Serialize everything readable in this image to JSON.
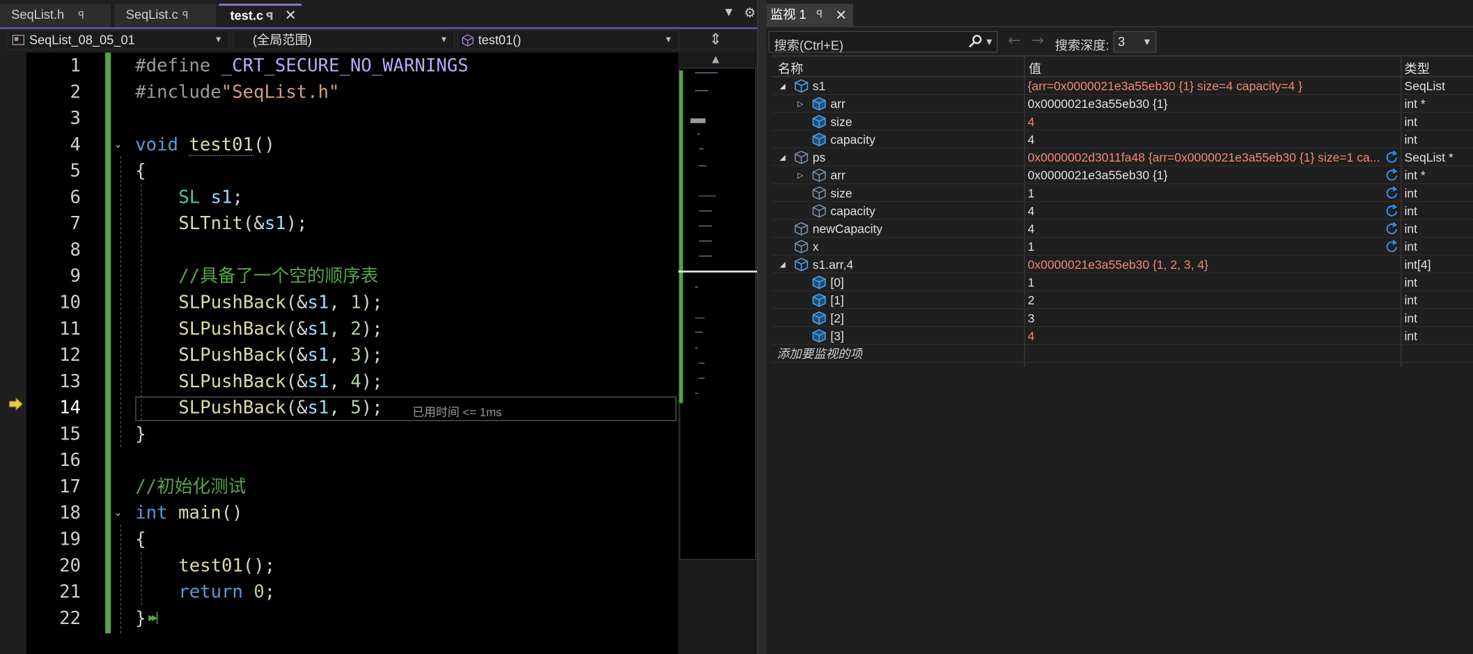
{
  "editor": {
    "tabs": [
      {
        "label": "SeqList.h"
      },
      {
        "label": "SeqList.c"
      },
      {
        "label": "test.c",
        "active": true
      }
    ],
    "nav": {
      "project": "SeqList_08_05_01",
      "scope": "(全局范围)",
      "member": "test01()"
    },
    "line_numbers": [
      "1",
      "2",
      "3",
      "4",
      "5",
      "6",
      "7",
      "8",
      "9",
      "10",
      "11",
      "12",
      "13",
      "14",
      "15",
      "16",
      "17",
      "18",
      "19",
      "20",
      "21",
      "22"
    ],
    "current_line": 14,
    "code": {
      "l1": {
        "a": "#define ",
        "b": "_CRT_SECURE_NO_WARNINGS"
      },
      "l2": {
        "a": "#include",
        "b": "\"SeqList.h\""
      },
      "l4": {
        "a": "void ",
        "b": "test01",
        "c": "()"
      },
      "l5": "{",
      "l6": {
        "a": "SL ",
        "b": "s1",
        "c": ";"
      },
      "l7": {
        "a": "SLTnit",
        "b": "(&",
        "c": "s1",
        "d": ");"
      },
      "l9": "//具备了一个空的顺序表",
      "l10": {
        "a": "SLPushBack",
        "b": "(&",
        "c": "s1",
        "d": ", ",
        "e": "1",
        "f": ");"
      },
      "l11": {
        "a": "SLPushBack",
        "b": "(&",
        "c": "s1",
        "d": ", ",
        "e": "2",
        "f": ");"
      },
      "l12": {
        "a": "SLPushBack",
        "b": "(&",
        "c": "s1",
        "d": ", ",
        "e": "3",
        "f": ");"
      },
      "l13": {
        "a": "SLPushBack",
        "b": "(&",
        "c": "s1",
        "d": ", ",
        "e": "4",
        "f": ");"
      },
      "l14": {
        "a": "SLPushBack",
        "b": "(&",
        "c": "s1",
        "d": ", ",
        "e": "5",
        "f": ");"
      },
      "l15": "}",
      "l17": "//初始化测试",
      "l18": {
        "a": "int ",
        "b": "main",
        "c": "()"
      },
      "l19": "{",
      "l20": {
        "a": "test01",
        "b": "();"
      },
      "l21": {
        "a": "return ",
        "b": "0",
        "c": ";"
      },
      "l22": "}"
    },
    "elapsed_hint": "已用时间 <= 1ms"
  },
  "watch": {
    "title": "监视 1",
    "search_placeholder": "搜索(Ctrl+E)",
    "depth_label": "搜索深度:",
    "depth_value": "3",
    "columns": {
      "name": "名称",
      "value": "值",
      "type": "类型"
    },
    "rows": [
      {
        "name": "s1",
        "value": "{arr=0x0000021e3a55eb30 {1} size=4 capacity=4 }",
        "type": "SeqList"
      },
      {
        "name": "arr",
        "value": "0x0000021e3a55eb30 {1}",
        "type": "int *"
      },
      {
        "name": "size",
        "value": "4",
        "type": "int"
      },
      {
        "name": "capacity",
        "value": "4",
        "type": "int"
      },
      {
        "name": "ps",
        "value": "0x0000002d3011fa48 {arr=0x0000021e3a55eb30 {1} size=1 ca...",
        "type": "SeqList *"
      },
      {
        "name": "arr",
        "value": "0x0000021e3a55eb30 {1}",
        "type": "int *"
      },
      {
        "name": "size",
        "value": "1",
        "type": "int"
      },
      {
        "name": "capacity",
        "value": "4",
        "type": "int"
      },
      {
        "name": "newCapacity",
        "value": "4",
        "type": "int"
      },
      {
        "name": "x",
        "value": "1",
        "type": "int"
      },
      {
        "name": "s1.arr,4",
        "value": "0x0000021e3a55eb30 {1, 2, 3, 4}",
        "type": "int[4]"
      },
      {
        "name": "[0]",
        "value": "1",
        "type": "int"
      },
      {
        "name": "[1]",
        "value": "2",
        "type": "int"
      },
      {
        "name": "[2]",
        "value": "3",
        "type": "int"
      },
      {
        "name": "[3]",
        "value": "4",
        "type": "int"
      }
    ],
    "add_item": "添加要监视的项"
  }
}
